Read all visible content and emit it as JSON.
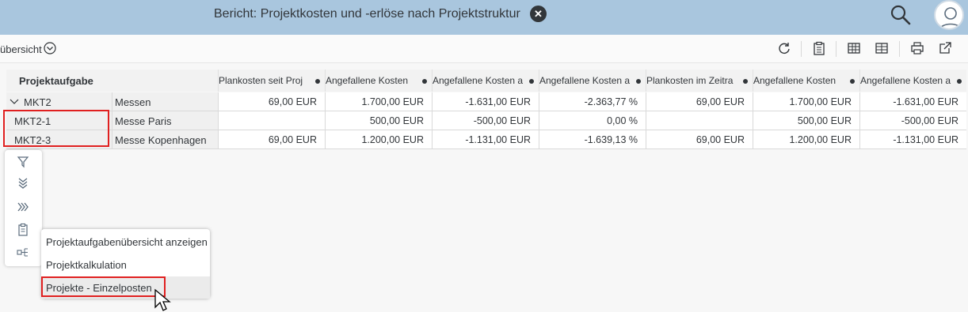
{
  "shell": {
    "title": "Bericht: Projektkosten und -erlöse nach Projektstruktur",
    "close_glyph": "✕",
    "search_icon": "search-icon",
    "avatar_icon": "user-avatar-icon"
  },
  "toolbar": {
    "view_label": "übersicht",
    "icons": [
      "refresh-icon",
      "clipboard-icon",
      "table-icon",
      "table-settings-icon",
      "print-icon",
      "share-icon"
    ]
  },
  "table": {
    "dimension_header": "Projektaufgabe",
    "columns": [
      "Plankosten seit Proj",
      "Angefallene Kosten",
      "Angefallene Kosten a",
      "Angefallene Kosten a",
      "Plankosten im Zeitra",
      "Angefallene Kosten",
      "Angefallene Kosten a"
    ],
    "rows": [
      {
        "key": "MKT2",
        "expanded_glyph": "∨",
        "text": "Messen",
        "values": [
          "69,00 EUR",
          "1.700,00 EUR",
          "-1.631,00 EUR",
          "-2.363,77 %",
          "69,00 EUR",
          "1.700,00 EUR",
          "-1.631,00 EUR"
        ]
      },
      {
        "key": "MKT2-1",
        "text": "Messe Paris",
        "values": [
          "",
          "500,00 EUR",
          "-500,00 EUR",
          "0,00 %",
          "",
          "500,00 EUR",
          "-500,00 EUR"
        ]
      },
      {
        "key": "MKT2-3",
        "text": "Messe Kopenhagen",
        "values": [
          "69,00 EUR",
          "1.200,00 EUR",
          "-1.131,00 EUR",
          "-1.639,13 %",
          "69,00 EUR",
          "1.200,00 EUR",
          "-1.131,00 EUR"
        ]
      }
    ]
  },
  "side_actions": [
    "filter-icon",
    "drill-down-icon",
    "drill-across-icon",
    "clipboard-icon",
    "jump-to-icon"
  ],
  "context_menu": {
    "items": [
      "Projektaufgabenübersicht anzeigen",
      "Projektkalkulation",
      "Projekte - Einzelposten"
    ],
    "hovered_index": 2
  },
  "colors": {
    "shell_bg": "#a9c6de",
    "highlight": "#e02020",
    "text": "#32363a"
  }
}
